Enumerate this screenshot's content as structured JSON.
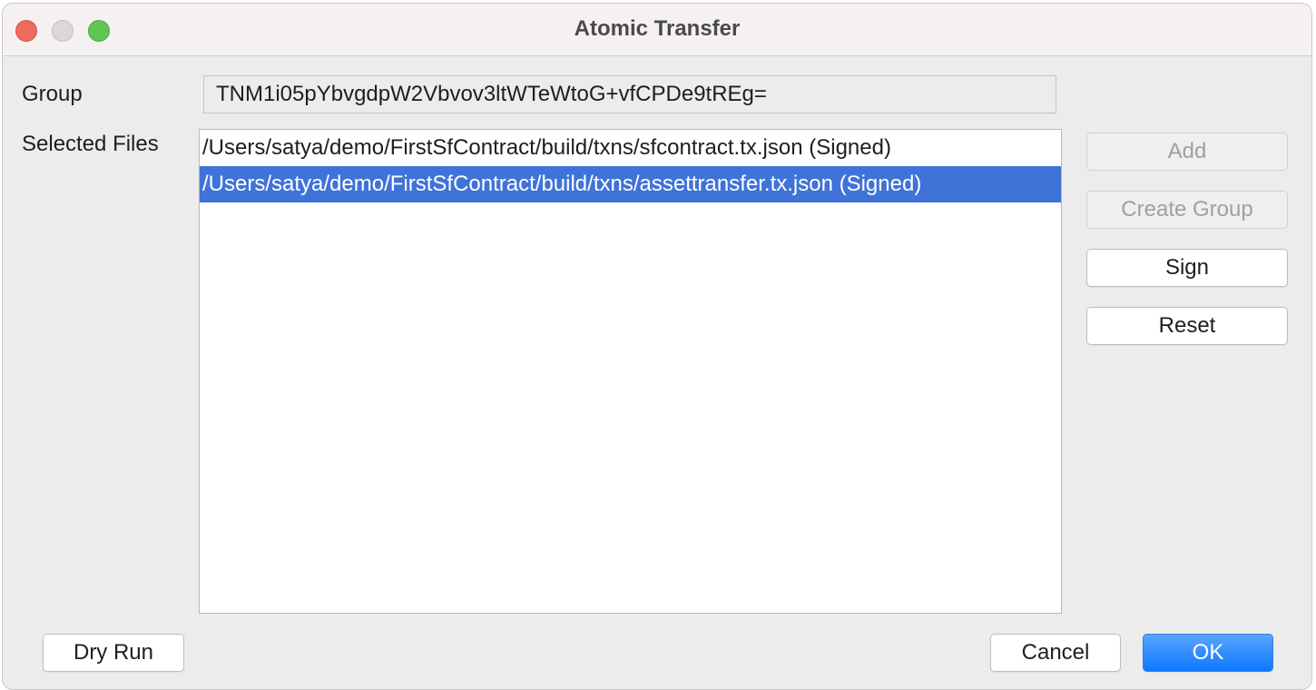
{
  "window": {
    "title": "Atomic Transfer",
    "controls": [
      "close",
      "minimize",
      "maximize"
    ]
  },
  "form": {
    "group_label": "Group",
    "group_value": "TNM1i05pYbvgdpW2Vbvov3ltWTeWtoG+vfCPDe9tREg=",
    "selected_files_label": "Selected Files",
    "files": [
      {
        "text": "/Users/satya/demo/FirstSfContract/build/txns/sfcontract.tx.json  (Signed)",
        "selected": false
      },
      {
        "text": "/Users/satya/demo/FirstSfContract/build/txns/assettransfer.tx.json  (Signed)",
        "selected": true
      }
    ]
  },
  "side_buttons": {
    "add": "Add",
    "create_group": "Create Group",
    "sign": "Sign",
    "reset": "Reset"
  },
  "footer": {
    "dry_run": "Dry Run",
    "cancel": "Cancel",
    "ok": "OK"
  },
  "colors": {
    "selection": "#3f73d8",
    "primary_button": "#0d78ff"
  }
}
